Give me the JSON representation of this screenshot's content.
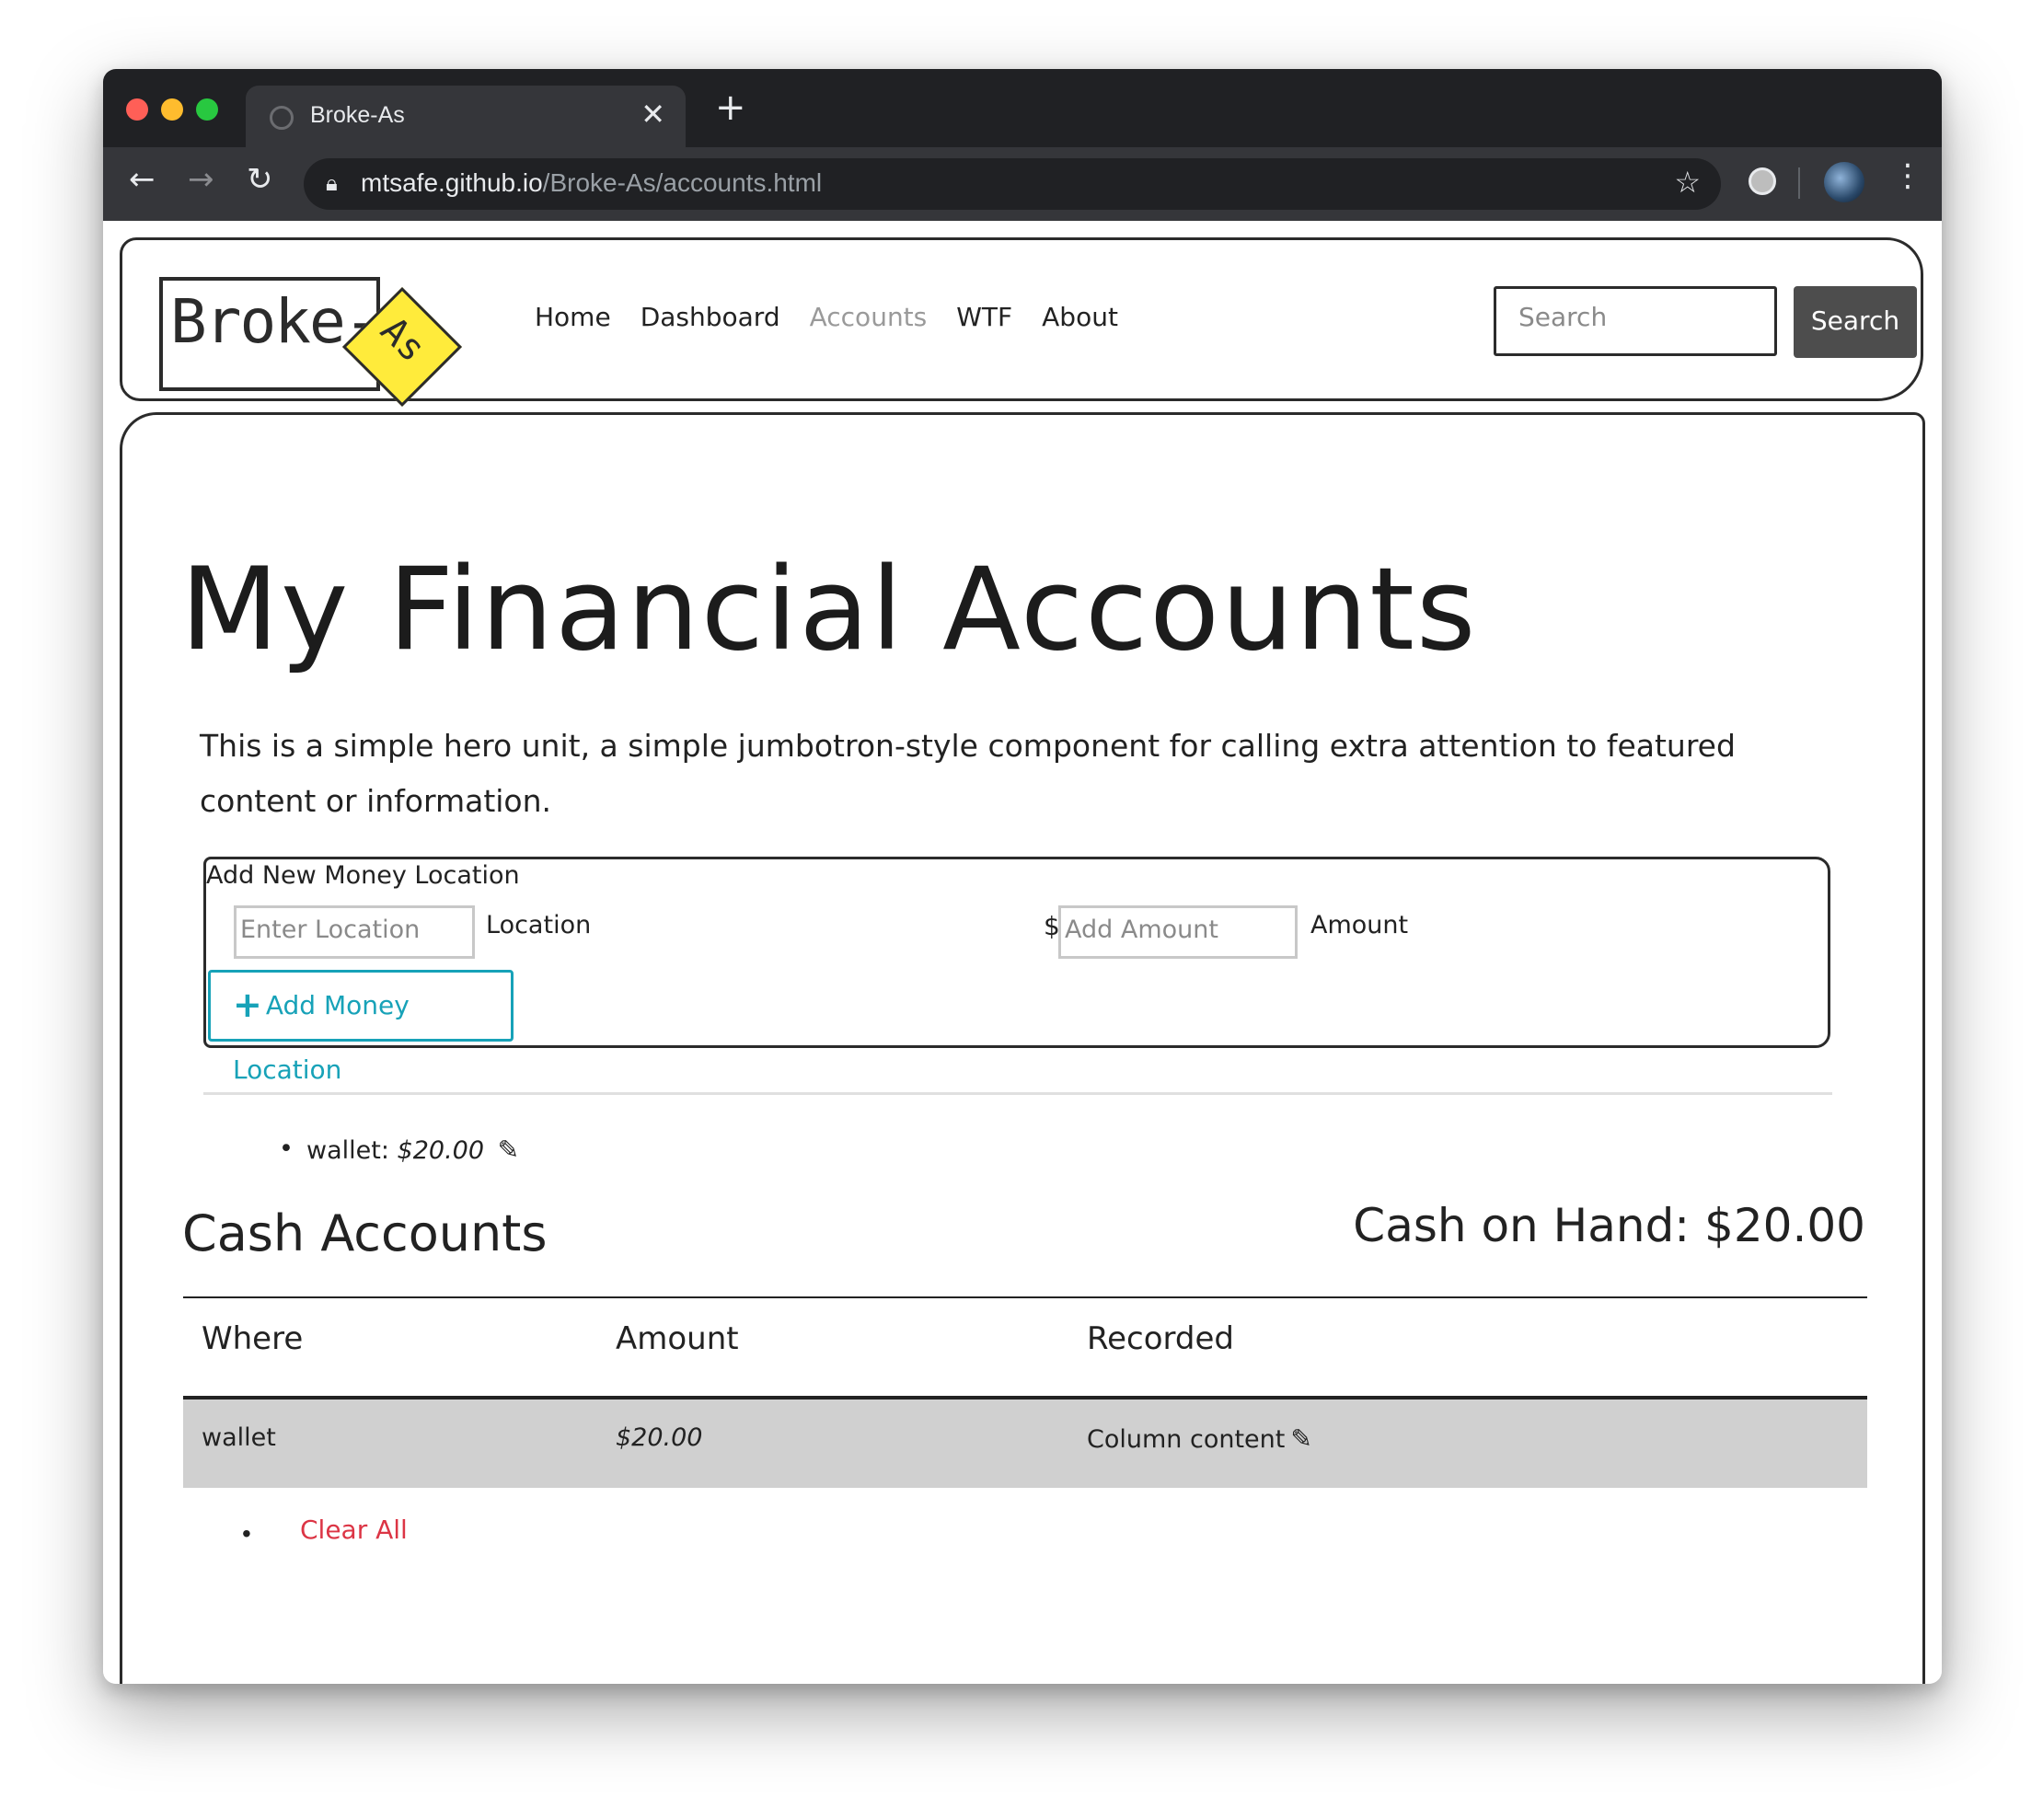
{
  "browser": {
    "tab_title": "Broke-As",
    "tab_close": "✕",
    "new_tab": "+",
    "url_host": "mtsafe.github.io",
    "url_path": "/Broke-As/accounts.html"
  },
  "site": {
    "logo_text": "Broke-",
    "logo_badge": "As",
    "nav": [
      "Home",
      "Dashboard",
      "Accounts",
      "WTF",
      "About"
    ],
    "active_nav": "Accounts",
    "search_placeholder": "Search",
    "search_button": "Search"
  },
  "hero": {
    "title": "My Financial Accounts",
    "text": "This is a simple hero unit, a simple jumbotron-style component for calling extra attention to featured content or information."
  },
  "add_form": {
    "title": "Add New Money Location",
    "location_placeholder": "Enter Location",
    "location_label": "Location",
    "currency": "$",
    "amount_placeholder": "Add Amount",
    "amount_label": "Amount",
    "button": "Add Money Location"
  },
  "locations": [
    {
      "name": "wallet:",
      "amount": "$20.00"
    }
  ],
  "cash": {
    "heading": "Cash Accounts",
    "on_hand": "Cash on Hand: $20.00",
    "columns": [
      "Where",
      "Amount",
      "Recorded"
    ],
    "rows": [
      {
        "where": "wallet",
        "amount": "$20.00",
        "recorded": "Column content"
      }
    ]
  },
  "clear_all": "Clear All",
  "colors": {
    "accent": "#17a2b8",
    "danger": "#dc3545",
    "logo_yellow": "#ffeb3b"
  }
}
